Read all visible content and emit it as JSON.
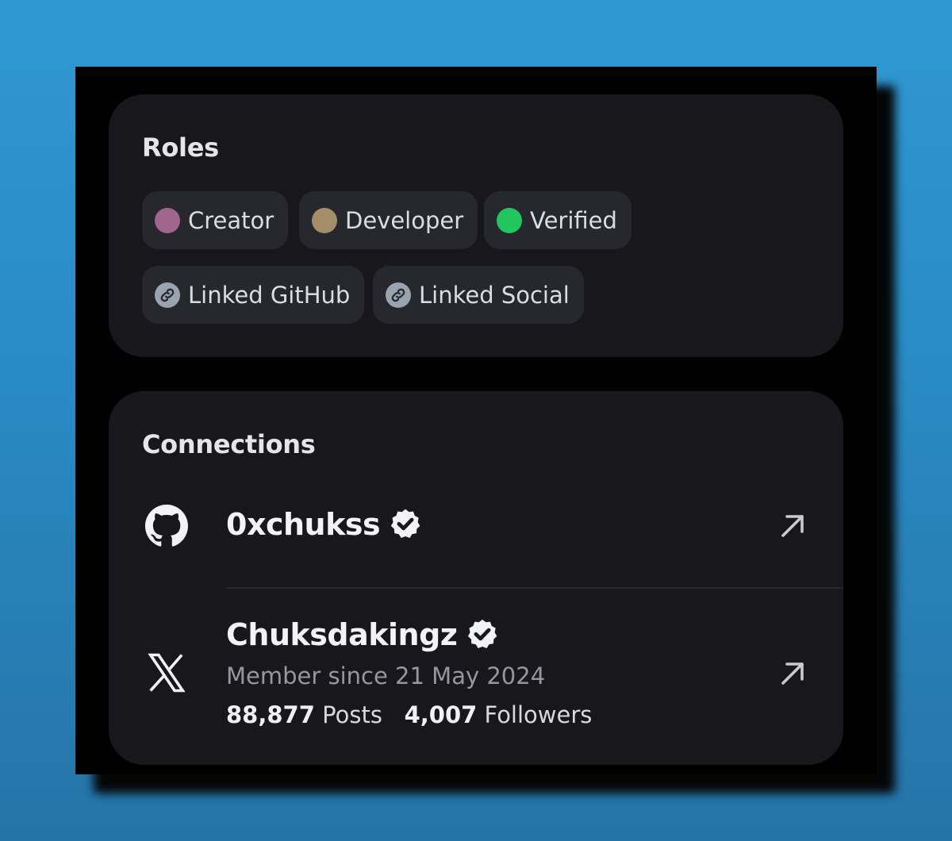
{
  "roles": {
    "title": "Roles",
    "items": [
      {
        "label": "Creator",
        "color": "#a1668e",
        "icon": "dot"
      },
      {
        "label": "Developer",
        "color": "#a48e6a",
        "icon": "dot"
      },
      {
        "label": "Verified",
        "color": "#23c55e",
        "icon": "dot"
      },
      {
        "label": "Linked GitHub",
        "icon": "link-icon"
      },
      {
        "label": "Linked Social",
        "icon": "link-icon"
      }
    ]
  },
  "connections": {
    "title": "Connections",
    "items": [
      {
        "platform_icon": "github-icon",
        "handle": "0xchukss",
        "verified": true
      },
      {
        "platform_icon": "x-icon",
        "handle": "Chuksdakingz",
        "verified": true,
        "member_since": "Member since 21 May 2024",
        "posts_count": "88,877",
        "posts_label": "Posts",
        "followers_count": "4,007",
        "followers_label": "Followers"
      }
    ]
  }
}
